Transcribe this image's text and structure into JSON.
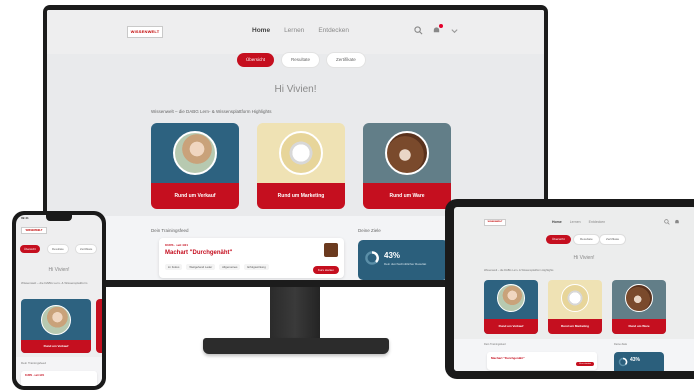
{
  "brand": {
    "logo_text": "WISSENWELT",
    "accent": "#c50f1f"
  },
  "nav": {
    "links": [
      "Home",
      "Lernen",
      "Entdecken"
    ]
  },
  "tabs": [
    "Übersicht",
    "Resultate",
    "Zertifikate"
  ],
  "greeting": "Hi Vivien!",
  "section_title": "Wissenwelt – die DABG Lern- & Wissensplattform Highlights",
  "cards": [
    {
      "label": "Rund um Verkauf"
    },
    {
      "label": "Rund um Marketing"
    },
    {
      "label": "Rund um Ware"
    }
  ],
  "training": {
    "title": "Dein Trainingsfeed",
    "item_title": "Machart \"Durchgenäht\"",
    "item_meta": "KURS · seit 4/21",
    "chips": [
      "im Fokus",
      "Weitgehend Leder",
      "Allgemeines",
      "Erfolgswirkung"
    ],
    "start_label": "Kurs starten"
  },
  "goals": {
    "title": "Deine Ziele",
    "percent": "43%",
    "caption": "Dein durchschnittlicher Resultat"
  },
  "phone": {
    "time": "09:41",
    "greeting": "Hi Vivien!",
    "section_title": "Wissenwelt – die DABG Lern- & Wissensplattform",
    "feed_title": "Dein Trainingsfeed"
  },
  "tablet": {
    "greeting": "Hi Vivien!",
    "section_title": "Wissenwelt – die DABG Lern- & Wissensplattform Highlights",
    "feed_title": "Dein Trainingsfeed",
    "goals_title": "Deine Ziele",
    "percent": "43%"
  }
}
